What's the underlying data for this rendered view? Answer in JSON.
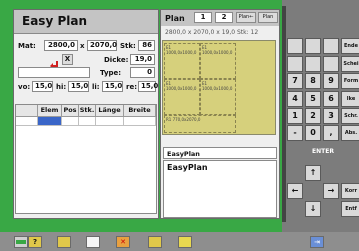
{
  "app": {
    "title": "Easy Plan"
  },
  "material": {
    "mat_label": "Mat:",
    "width": "2800,0",
    "x_sep": "x",
    "height": "2070,0",
    "stk_label": "Stk:",
    "stk": "86",
    "x_button": "X",
    "dicke_label": "Dicke:",
    "dicke": "19,0",
    "type_label": "Type:",
    "type": "0",
    "vo_label": "vo:",
    "vo": "15,0",
    "hi_label": "hi:",
    "hi": "15,0",
    "li_label": "li:",
    "li": "15,0",
    "re_label": "re:",
    "re": "15,0"
  },
  "grid": {
    "columns": [
      "Elem",
      "Pos",
      "Stk.",
      "Länge",
      "Breite"
    ]
  },
  "plan": {
    "label": "Plan",
    "current": "1",
    "total": "2",
    "prev_label": "Plan←",
    "next_label": "Plan",
    "summary": "2800,0 x 2070,0 x 19,0 Stk: 12",
    "pieces": [
      "E1 1000,0x1000,0",
      "E1 1000,0x1000,0",
      "E1 1000,0x1000,0",
      "E1 1000,0x1000,0",
      "R1 770,0x2070,0"
    ]
  },
  "notes": {
    "title": "EasyPlan",
    "text": "EasyPlan"
  },
  "keypad": {
    "keys": [
      "7",
      "8",
      "9",
      "4",
      "5",
      "6",
      "1",
      "2",
      "3",
      "-",
      "0",
      ","
    ],
    "side": [
      "Ende",
      "Schei",
      "Form",
      "Ike",
      "Schr.",
      "Abs."
    ],
    "enter_label": "ENTER",
    "arrow_up": "↑",
    "arrow_down": "↓",
    "arrow_left": "←",
    "arrow_right": "→",
    "korr_label": "Korr",
    "entf_label": "Entf"
  },
  "toolbar": {
    "icons": [
      "help-icon",
      "open-icon",
      "new-icon",
      "delete-icon",
      "folder-icon",
      "print-icon",
      "exit-icon"
    ],
    "help": "?",
    "delete": "✕",
    "exit": "⇥"
  },
  "colors": {
    "frame": "#39a845",
    "plan_area": "#d6d07c",
    "selected_cell": "#3a66c8",
    "arrow_red": "#d02020"
  }
}
